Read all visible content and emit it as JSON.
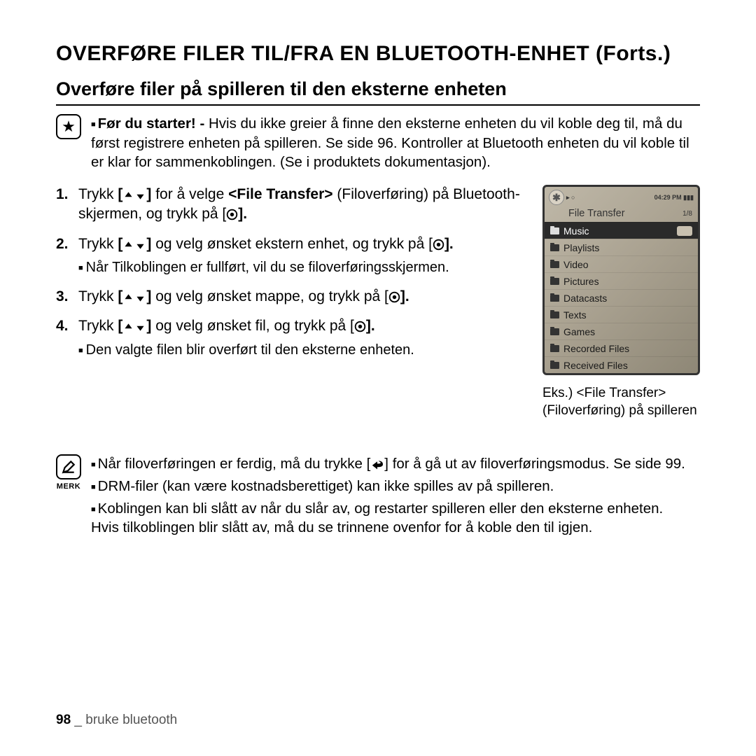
{
  "title": "OVERFØRE FILER TIL/FRA EN BLUETOOTH-ENHET (Forts.)",
  "subtitle": "Overføre filer på spilleren til den eksterne enheten",
  "precheck": {
    "lead": "Før du starter! -",
    "text": "  Hvis du ikke greier å finne den eksterne enheten du vil koble deg til, må du først registrere enheten på spilleren. Se side 96. Kontroller at Bluetooth enheten du vil koble til er klar for sammenkoblingen. (Se i produktets dokumentasjon)."
  },
  "steps": {
    "s1a": "Trykk ",
    "s1b": " for å velge ",
    "s1bold": "<File Transfer>",
    "s1c": " (Filoverføring) på Bluetooth-skjermen, og trykk på [",
    "s1d": "].",
    "s2a": "Trykk ",
    "s2b": " og velg ønsket ekstern enhet, og trykk på [",
    "s2c": "].",
    "s2sub": "Når Tilkoblingen er fullført, vil du se filoverføringsskjermen.",
    "s3a": "Trykk ",
    "s3b": " og velg ønsket mappe, og trykk på [",
    "s3c": "].",
    "s4a": "Trykk ",
    "s4b": " og velg ønsket fil, og trykk på [",
    "s4c": "].",
    "s4sub": "Den valgte filen blir overført til den eksterne enheten."
  },
  "device": {
    "time": "04:29 PM",
    "screen_title": "File Transfer",
    "page": "1/8",
    "items": [
      "Music",
      "Playlists",
      "Video",
      "Pictures",
      "Datacasts",
      "Texts",
      "Games",
      "Recorded Files",
      "Received Files"
    ],
    "caption": "Eks.) <File Transfer> (Filoverføring) på spilleren"
  },
  "merk": {
    "label": "MERK",
    "n1a": "Når filoverføringen er ferdig, må du trykke [",
    "n1b": "] for å gå ut av filoverføringsmodus. Se side 99.",
    "n2": "DRM-filer (kan være kostnadsberettiget) kan ikke spilles av på spilleren.",
    "n3": "Koblingen kan bli slått av når du slår av, og restarter spilleren eller den eksterne enheten.",
    "n3b": "Hvis tilkoblingen blir slått av, må du se trinnene ovenfor for å koble den til igjen."
  },
  "footer": {
    "page": "98",
    "sep": " _ ",
    "section": "bruke bluetooth"
  },
  "nums": {
    "n1": "1.",
    "n2": "2.",
    "n3": "3.",
    "n4": "4."
  },
  "brackets": {
    "open": "[",
    "close": "]"
  }
}
